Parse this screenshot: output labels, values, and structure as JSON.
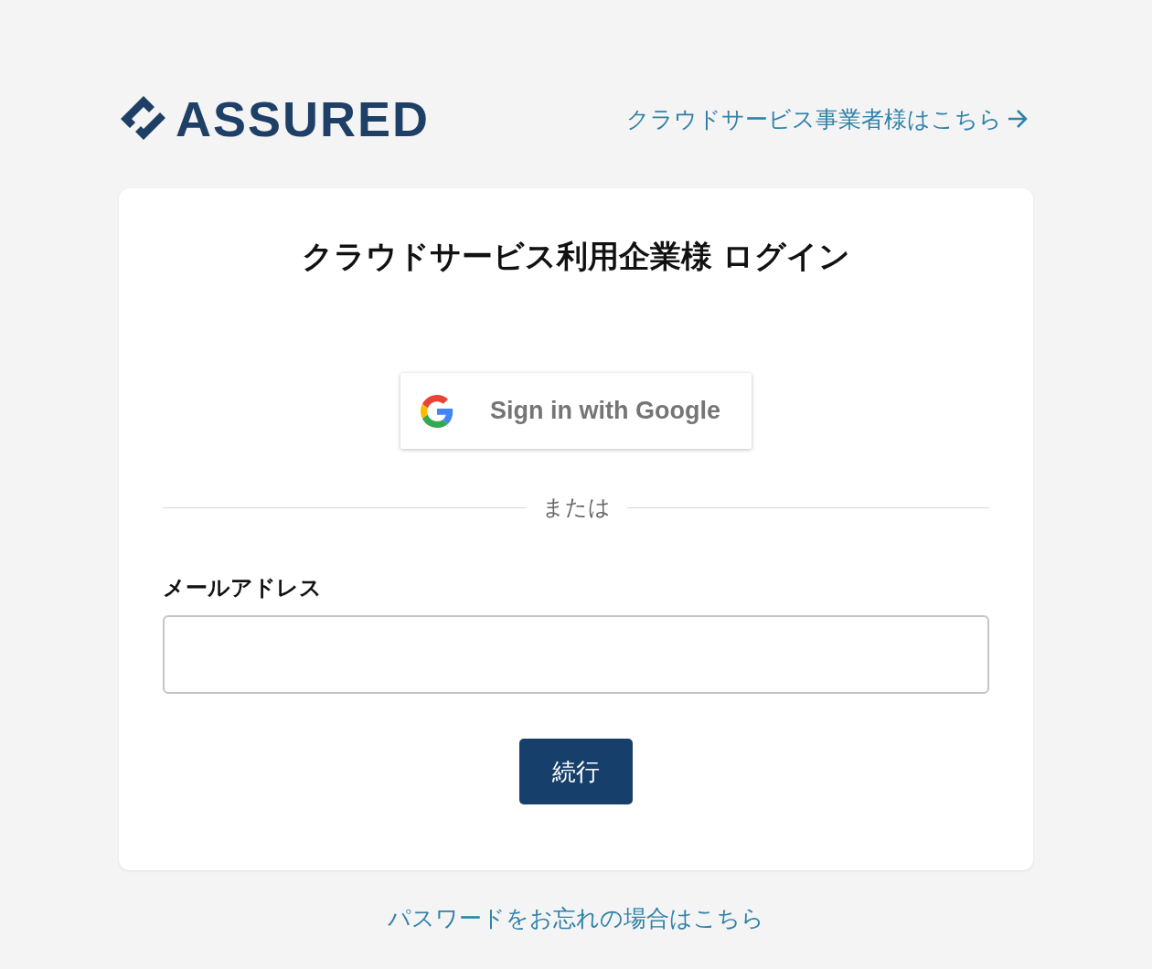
{
  "header": {
    "logo_text": "ASSURED",
    "provider_link": "クラウドサービス事業者様はこちら"
  },
  "card": {
    "title": "クラウドサービス利用企業様 ログイン",
    "google_button": "Sign in with Google",
    "divider": "または",
    "email_label": "メールアドレス",
    "submit_button": "続行"
  },
  "forgot_password_link": "パスワードをお忘れの場合はこちら"
}
